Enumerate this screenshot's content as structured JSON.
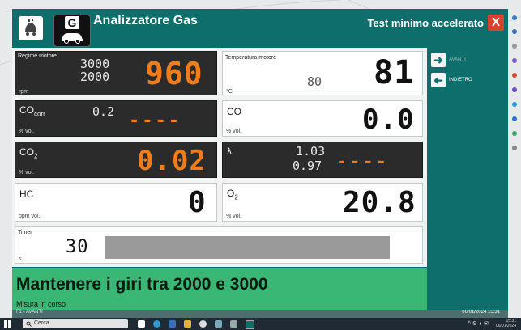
{
  "header": {
    "title": "Analizzatore Gas",
    "test_title": "Test minimo accelerato",
    "g_icon_letter": "G",
    "close_label": "X"
  },
  "tiles": {
    "rpm": {
      "label": "Regime motore",
      "unit": "rpm",
      "target_high": "3000",
      "target_low": "2000",
      "value": "960"
    },
    "temp": {
      "label": "Temperatura motore",
      "unit": "°C",
      "reference": "80",
      "value": "81"
    },
    "cocorr": {
      "label": "CO",
      "label_sub": "corr",
      "unit": "% vol.",
      "small": "0.2",
      "value": "----"
    },
    "co": {
      "label": "CO",
      "unit": "% vol.",
      "value": "0.0"
    },
    "co2": {
      "label": "CO",
      "label_sub": "2",
      "unit": "% vol.",
      "value": "0.02"
    },
    "lambda": {
      "label": "λ",
      "range_high": "1.03",
      "range_low": "0.97",
      "value": "----"
    },
    "hc": {
      "label": "HC",
      "unit": "ppm vol.",
      "value": "0"
    },
    "o2": {
      "label": "O",
      "label_sub": "2",
      "unit": "% vol.",
      "value": "20.8"
    },
    "timer": {
      "label": "Timer",
      "unit": "s",
      "value": "30"
    }
  },
  "message": {
    "text": "Mantenere i giri tra 2000 e 3000",
    "status": "Misura in corso",
    "footer_left": "F1 - AVANTI",
    "datetime": "06/01/2024 15:31"
  },
  "nav": {
    "forward_label": "AVANTI",
    "back_label": "INDIETRO"
  },
  "taskbar": {
    "search_placeholder": "Cerca",
    "time": "15:31",
    "date": "06/01/2024"
  },
  "colors": {
    "teal": "#0d6e6c",
    "green": "#3bb775",
    "orange": "#f07d1a",
    "dark_tile": "#2b2b2b"
  }
}
